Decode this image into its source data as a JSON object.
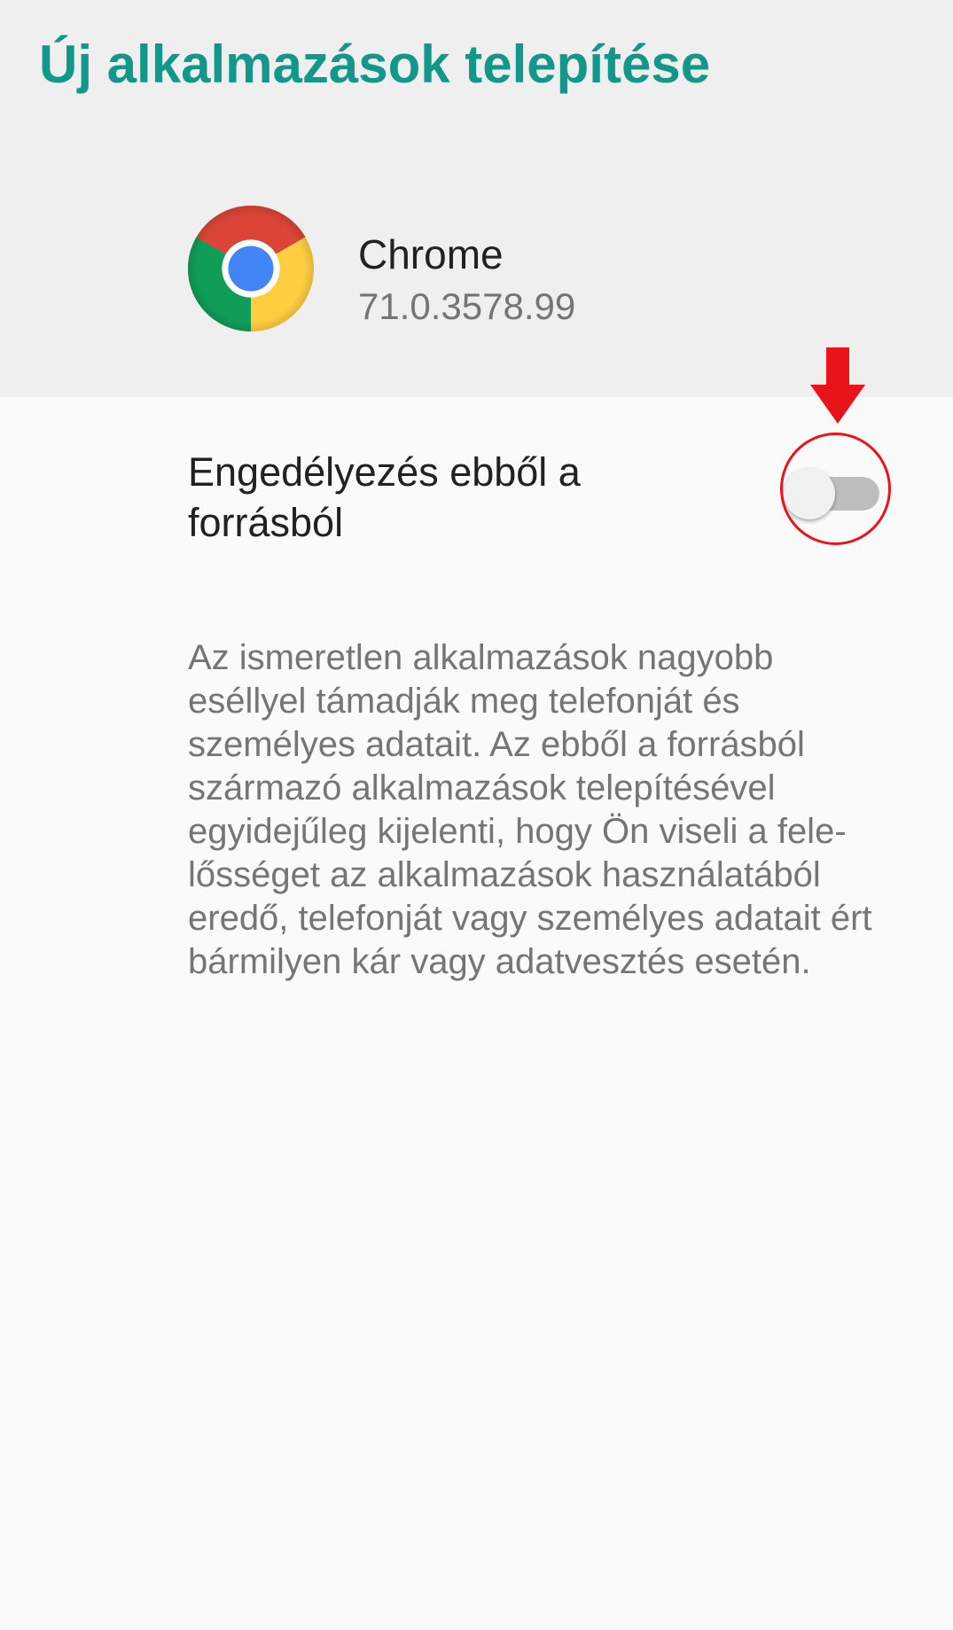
{
  "page": {
    "title": "Új alkalmazások telepítése"
  },
  "app": {
    "name": "Chrome",
    "version": "71.0.3578.99",
    "icon": "chrome-logo-icon"
  },
  "setting": {
    "label_line1": "Engedélyezés ebből a",
    "label_line2": "forrásból",
    "enabled": false
  },
  "description": {
    "lines": [
      "Az ismeretlen alkalmazások nagyobb",
      "eséllyel támadják meg telefonját és",
      "személyes adatait. Az ebből a forrásból",
      "származó alkalmazások telepítésével",
      "egyidejűleg kijelenti, hogy Ön viseli a fele-",
      "lősséget az alkalmazások használatából",
      "eredő, telefonját vagy személyes adatait ért",
      "bármilyen kár vagy adatvesztés esetén."
    ]
  },
  "colors": {
    "accent": "#12988a",
    "annotation": "#e8141a",
    "header_bg": "#efefef",
    "body_bg": "#fafafa"
  }
}
